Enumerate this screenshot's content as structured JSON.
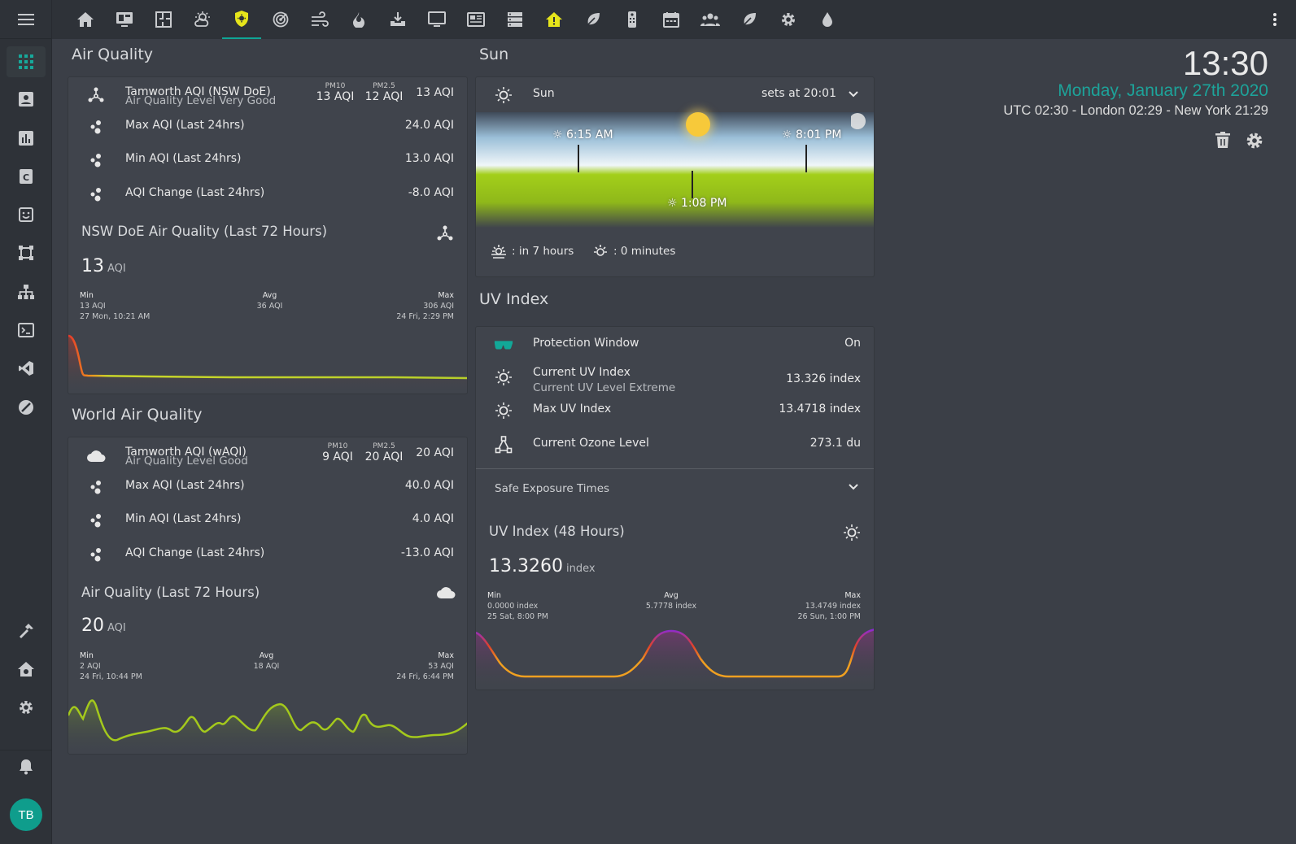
{
  "sidebar": {
    "menu_icon": "menu-icon",
    "items": [
      "dashboard-grid-icon",
      "account-box-icon",
      "chart-bar-icon",
      "calendar-c-icon",
      "clipboard-face-icon",
      "vector-square-icon",
      "sitemap-icon",
      "terminal-icon",
      "vscode-icon",
      "compass-off-icon"
    ],
    "bottom_items": [
      "hammer-icon",
      "home-cog-icon",
      "cog-icon"
    ],
    "notifications_icon": "bell-icon",
    "avatar_initials": "TB"
  },
  "topbar": {
    "tabs": [
      "home-icon",
      "monitor-dashboard-icon",
      "floor-plan-icon",
      "weather-partly-cloudy-icon",
      "shield-sun-icon",
      "radar-icon",
      "weather-windy-icon",
      "fire-icon",
      "download-box-icon",
      "monitor-icon",
      "newspaper-icon",
      "server-icon",
      "home-alert-icon",
      "leaf-icon",
      "remote-icon",
      "calendar-icon",
      "account-group-icon",
      "leaf-alt-icon",
      "cog-icon",
      "water-icon"
    ],
    "active_tab": 4,
    "more_icon": "dots-vertical-icon"
  },
  "air_quality": {
    "title": "Air Quality",
    "main": {
      "name": "Tamworth AQI (NSW DoE)",
      "sub": "Air Quality Level Very Good",
      "pm10_label": "PM10",
      "pm10": "13 AQI",
      "pm25_label": "PM2.5",
      "pm25": "12 AQI",
      "value": "13 AQI"
    },
    "rows": [
      {
        "name": "Max AQI (Last 24hrs)",
        "value": "24.0 AQI"
      },
      {
        "name": "Min AQI (Last 24hrs)",
        "value": "13.0 AQI"
      },
      {
        "name": "AQI Change (Last 24hrs)",
        "value": "-8.0 AQI"
      }
    ],
    "graph": {
      "title": "NSW DoE Air Quality (Last 72 Hours)",
      "value": "13",
      "unit": "AQI",
      "min_label": "Min",
      "min_value": "13 AQI",
      "min_time": "27 Mon, 10:21 AM",
      "avg_label": "Avg",
      "avg_value": "36 AQI",
      "max_label": "Max",
      "max_value": "306 AQI",
      "max_time": "24 Fri, 2:29 PM"
    }
  },
  "world_air_quality": {
    "title": "World Air Quality",
    "main": {
      "name": "Tamworth AQI (wAQI)",
      "sub": "Air Quality Level Good",
      "pm10_label": "PM10",
      "pm10": "9 AQI",
      "pm25_label": "PM2.5",
      "pm25": "20 AQI",
      "value": "20 AQI"
    },
    "rows": [
      {
        "name": "Max AQI (Last 24hrs)",
        "value": "40.0 AQI"
      },
      {
        "name": "Min AQI (Last 24hrs)",
        "value": "4.0 AQI"
      },
      {
        "name": "AQI Change (Last 24hrs)",
        "value": "-13.0 AQI"
      }
    ],
    "graph": {
      "title": "Air Quality (Last 72 Hours)",
      "value": "20",
      "unit": "AQI",
      "min_label": "Min",
      "min_value": "2 AQI",
      "min_time": "24 Fri, 10:44 PM",
      "avg_label": "Avg",
      "avg_value": "18 AQI",
      "max_label": "Max",
      "max_value": "53 AQI",
      "max_time": "24 Fri, 6:44 PM"
    }
  },
  "sun": {
    "title": "Sun",
    "entity": "Sun",
    "sets_at": "sets at 20:01",
    "sunrise": "6:15 AM",
    "noon": "1:08 PM",
    "sunset": "8:01 PM",
    "next_dawn": ": in 7 hours",
    "daylight_change": ": 0 minutes"
  },
  "uv_index": {
    "title": "UV Index",
    "rows": [
      {
        "name": "Protection Window",
        "value": "On"
      },
      {
        "name": "Current UV Index",
        "sub": "Current UV Level Extreme",
        "value": "13.326 index"
      },
      {
        "name": "Max UV Index",
        "value": "13.4718 index"
      },
      {
        "name": "Current Ozone Level",
        "value": "273.1 du"
      }
    ],
    "safe_exposure": "Safe Exposure Times",
    "graph": {
      "title": "UV Index (48 Hours)",
      "value": "13.3260",
      "unit": "index",
      "min_label": "Min",
      "min_value": "0.0000 index",
      "min_time": "25 Sat, 8:00 PM",
      "avg_label": "Avg",
      "avg_value": "5.7778 index",
      "max_label": "Max",
      "max_value": "13.4749 index",
      "max_time": "26 Sun, 1:00 PM"
    }
  },
  "clock": {
    "time": "13:30",
    "date": "Monday, January 27th 2020",
    "timezones": "UTC 02:30 - London 02:29 - New York 21:29"
  }
}
